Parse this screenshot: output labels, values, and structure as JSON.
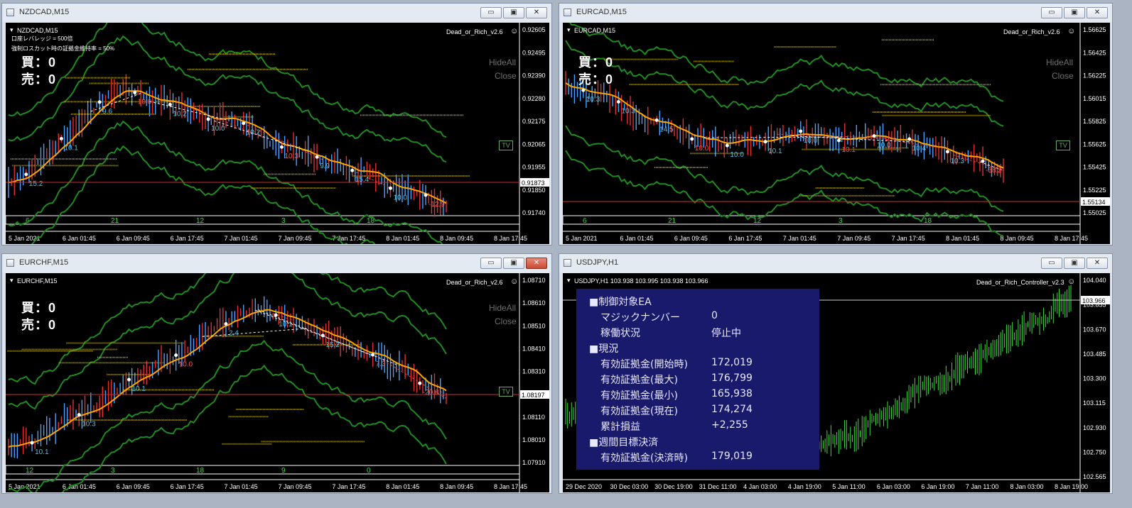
{
  "windows": [
    {
      "title": "NZDCAD,M15",
      "symbol_label": "NZDCAD,M15",
      "ea_name": "Dead_or_Rich_v2.6",
      "lines": [
        "口座レバレッジ = 500倍",
        "強制ロスカット時の証拠金維持率 = 50%"
      ],
      "buy": "買：0",
      "sell": "売：0",
      "hideall": "HideAll",
      "close": "Close",
      "tv": "TV",
      "price_box": "0.91873",
      "prices": [
        "0.92605",
        "0.92495",
        "0.92390",
        "0.92280",
        "0.92175",
        "0.92065",
        "0.91955",
        "0.91850",
        "0.91740"
      ],
      "dates": [
        "5 Jan 2021",
        "6 Jan 01:45",
        "6 Jan 09:45",
        "6 Jan 17:45",
        "7 Jan 01:45",
        "7 Jan 09:45",
        "7 Jan 17:45",
        "8 Jan 01:45",
        "8 Jan 09:45",
        "8 Jan 17:45"
      ],
      "osc": [
        "6",
        "21",
        "12",
        "3",
        "18"
      ],
      "trade_labels": [
        "15.2",
        "10.1",
        "9.6",
        "10.0",
        "10.2",
        "10.0",
        "10.2",
        "10.3",
        "9.9",
        "15.4",
        "10.0",
        "-12.9"
      ]
    },
    {
      "title": "EURCAD,M15",
      "symbol_label": "EURCAD,M15",
      "ea_name": "Dead_or_Rich_v2.6",
      "buy": "買：0",
      "sell": "売：0",
      "hideall": "HideAll",
      "close": "Close",
      "tv": "TV",
      "price_box": "1.55134",
      "prices": [
        "1.56625",
        "1.56425",
        "1.56225",
        "1.56015",
        "1.55825",
        "1.55625",
        "1.55425",
        "1.55225",
        "1.55025"
      ],
      "dates": [
        "5 Jan 2021",
        "6 Jan 01:45",
        "6 Jan 09:45",
        "6 Jan 17:45",
        "7 Jan 01:45",
        "7 Jan 09:45",
        "7 Jan 17:45",
        "8 Jan 01:45",
        "8 Jan 09:45",
        "8 Jan 17:45"
      ],
      "osc": [
        "6",
        "21",
        "12",
        "3",
        "18"
      ],
      "trade_labels": [
        "10.3",
        "10.3",
        "14.5",
        "10.0",
        "10.0",
        "10.1",
        "10.0",
        "10.1",
        "10.0",
        "10.4",
        "10.3",
        "-38.2"
      ]
    },
    {
      "title": "EURCHF,M15",
      "symbol_label": "EURCHF,M15",
      "ea_name": "Dead_or_Rich_v2.6",
      "buy": "買：0",
      "sell": "売：0",
      "hideall": "HideAll",
      "close": "Close",
      "tv": "TV",
      "price_box": "1.08197",
      "prices": [
        "1.08710",
        "1.08610",
        "1.08510",
        "1.08410",
        "1.08310",
        "1.08210",
        "1.08110",
        "1.08010",
        "1.07910"
      ],
      "dates": [
        "5 Jan 2021",
        "6 Jan 01:45",
        "6 Jan 09:45",
        "6 Jan 17:45",
        "7 Jan 01:45",
        "7 Jan 09:45",
        "7 Jan 17:45",
        "8 Jan 01:45",
        "8 Jan 09:45",
        "8 Jan 17:45"
      ],
      "osc": [
        "12",
        "3",
        "18",
        "9",
        "0"
      ],
      "trade_labels": [
        "10.1",
        "10.3",
        "10.1",
        "10.0",
        "2.4",
        "10.1",
        "15.2",
        "7.3",
        "-20.8"
      ]
    },
    {
      "title": "USDJPY,H1",
      "symbol_label": "USDJPY,H1  103.938 103.995 103.938 103.966",
      "ea_name": "Dead_or_Rich_Controller_v2.3",
      "price_box": "103.966",
      "prices": [
        "104.040",
        "103.855",
        "103.670",
        "103.485",
        "103.300",
        "103.115",
        "102.930",
        "102.750",
        "102.565"
      ],
      "dates": [
        "29 Dec 2020",
        "30 Dec 03:00",
        "30 Dec 19:00",
        "31 Dec 11:00",
        "4 Jan 03:00",
        "4 Jan 19:00",
        "5 Jan 11:00",
        "6 Jan 03:00",
        "6 Jan 19:00",
        "7 Jan 11:00",
        "8 Jan 03:00",
        "8 Jan 19:00"
      ],
      "panel": {
        "h1": "■制御対象EA",
        "magic_label": "マジックナンバー",
        "magic_value": "0",
        "status_label": "稼働状況",
        "status_value": "停止中",
        "h2": "■現況",
        "eq_start_label": "有効証拠金(開始時)",
        "eq_start_value": "172,019",
        "eq_max_label": "有効証拠金(最大)",
        "eq_max_value": "176,799",
        "eq_min_label": "有効証拠金(最小)",
        "eq_min_value": "165,938",
        "eq_now_label": "有効証拠金(現在)",
        "eq_now_value": "174,274",
        "pnl_label": "累計損益",
        "pnl_value": "+2,255",
        "h3": "■週間目標決済",
        "eq_settle_label": "有効証拠金(決済時)",
        "eq_settle_value": "179,019"
      }
    }
  ],
  "window_controls": {
    "minimize": "▭",
    "maximize": "▣",
    "close": "✕"
  },
  "colors": {
    "bb": "#1f8a1f",
    "ma": "#ffa500",
    "bull": "#4aa3ff",
    "bear": "#e23030",
    "green_candle": "#3fdc3f",
    "panel": "#1a1a6c",
    "price_line": "#c83030",
    "level": "#b8a000"
  }
}
